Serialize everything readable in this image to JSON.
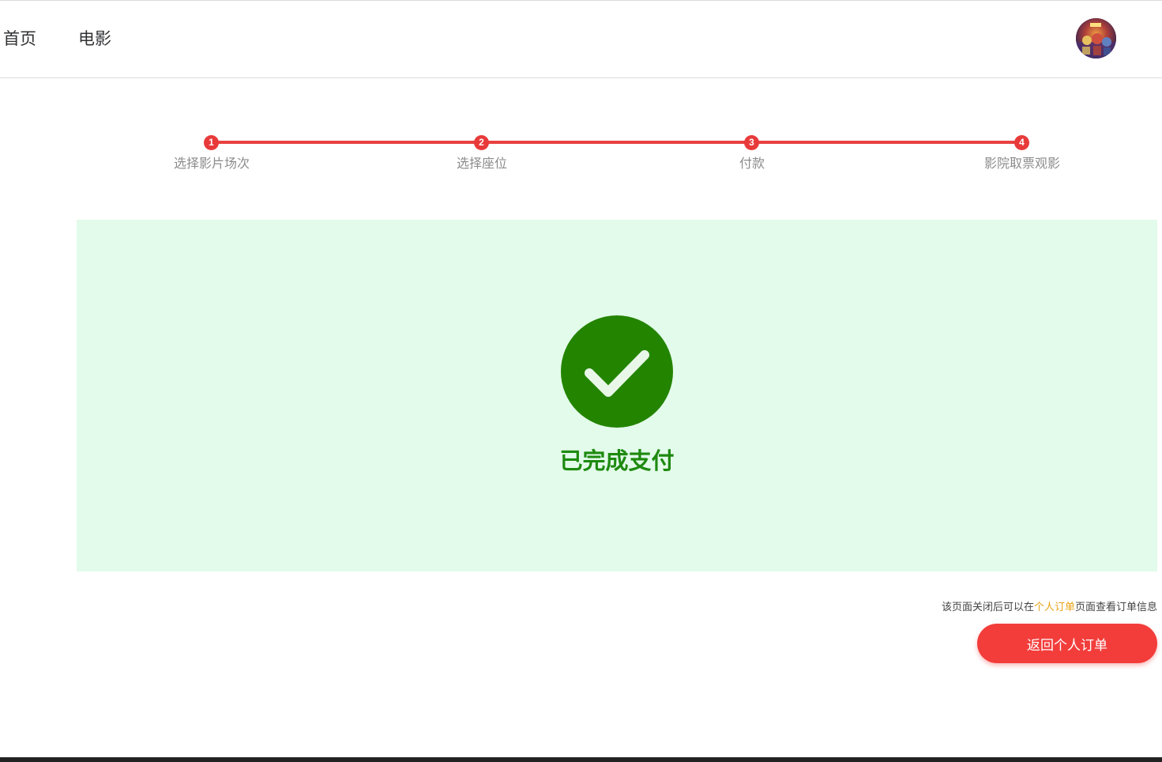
{
  "nav": {
    "home": "首页",
    "movie": "电影"
  },
  "steps": [
    {
      "number": "1",
      "label": "选择影片场次"
    },
    {
      "number": "2",
      "label": "选择座位"
    },
    {
      "number": "3",
      "label": "付款"
    },
    {
      "number": "4",
      "label": "影院取票观影"
    }
  ],
  "success": {
    "message": "已完成支付"
  },
  "hint": {
    "before": "该页面关闭后可以在",
    "link": "个人订单",
    "after": "页面查看订单信息"
  },
  "actions": {
    "back_label": "返回个人订单"
  },
  "colors": {
    "accent": "#f23d3b",
    "success_bg": "#e3fbea",
    "success_green": "#1e8a10",
    "link": "#e8a317"
  }
}
